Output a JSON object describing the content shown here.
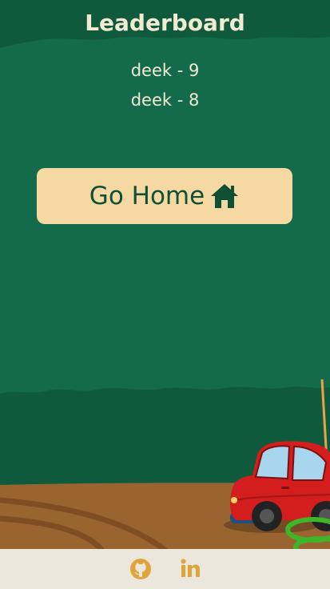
{
  "header": {
    "title": "Leaderboard"
  },
  "leaderboard": {
    "entries": [
      {
        "text": "deek - 9"
      },
      {
        "text": "deek - 8"
      }
    ]
  },
  "home_button": {
    "label": "Go Home",
    "icon": "home-icon"
  },
  "footer": {
    "links": [
      {
        "icon": "github-icon"
      },
      {
        "icon": "linkedin-icon"
      }
    ]
  },
  "colors": {
    "background": "#146b4b",
    "header_band": "#0f5a3c",
    "ground": "#9a6430",
    "button": "#f6d9a2",
    "button_text": "#0f4f34",
    "footer_bg": "#ece7dd",
    "footer_icons": "#e0a53a",
    "car_body": "#d41e1e"
  }
}
